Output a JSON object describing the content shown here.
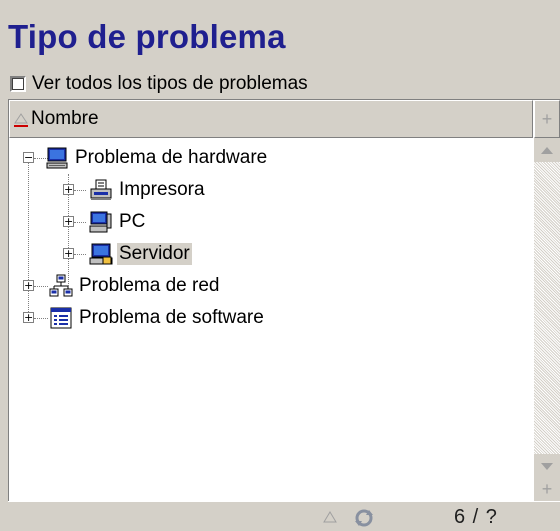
{
  "panel": {
    "title": "Tipo de problema",
    "checkbox_label": "Ver todos los tipos de problemas",
    "checkbox_checked": false
  },
  "tree": {
    "column_header": "Nombre",
    "corner_label": "+",
    "scroll_plus": "+",
    "nodes": [
      {
        "label": "Problema de hardware",
        "icon": "computer-icon",
        "expanded": true
      },
      {
        "label": "Impresora",
        "icon": "printer-icon",
        "expanded": false
      },
      {
        "label": "PC",
        "icon": "pc-icon",
        "expanded": false
      },
      {
        "label": "Servidor",
        "icon": "server-icon",
        "expanded": false,
        "selected": true
      },
      {
        "label": "Problema de red",
        "icon": "network-icon",
        "expanded": false
      },
      {
        "label": "Problema de software",
        "icon": "software-icon",
        "expanded": false
      }
    ]
  },
  "footer": {
    "count": "6 / ?"
  },
  "colors": {
    "title": "#1f1f8f",
    "window_bg": "#d4d0c8",
    "selection": "#d4d0c8"
  }
}
